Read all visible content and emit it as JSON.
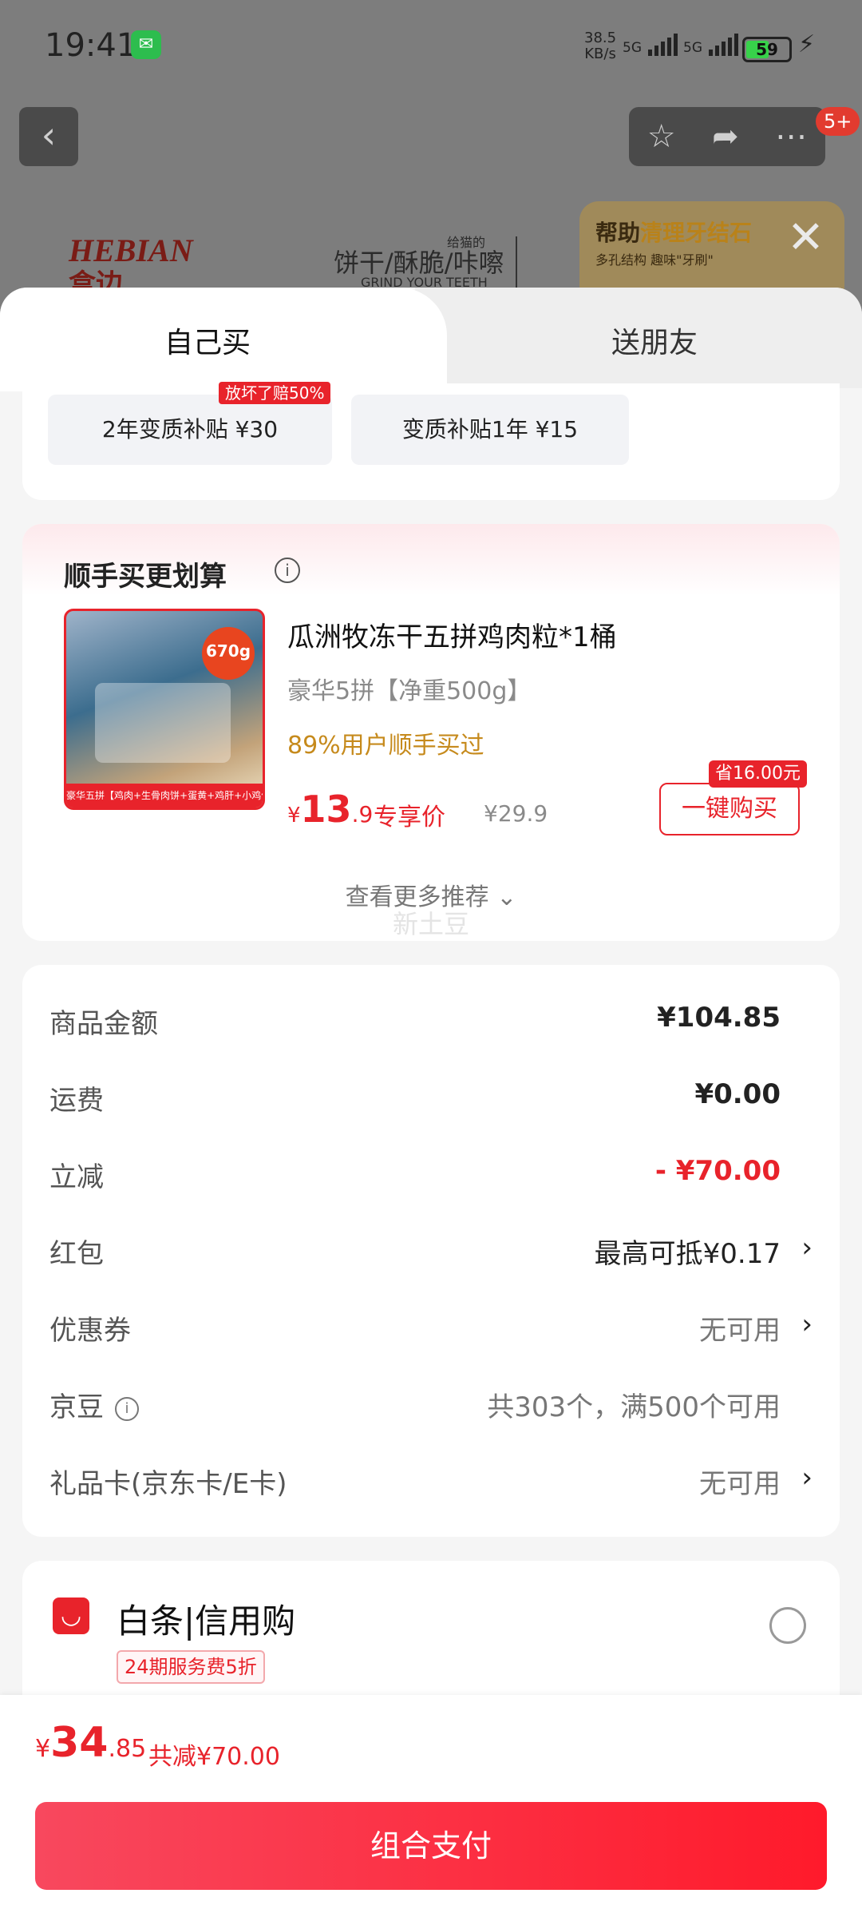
{
  "status_bar": {
    "time": "19:41",
    "net_speed_value": "38.5",
    "net_speed_unit": "KB/s",
    "sim1": "5G",
    "sim2": "5G",
    "battery": "59",
    "battery_level": 0.59
  },
  "top_bar": {
    "badge": "5+"
  },
  "background_banner": {
    "brand_en": "HEBIAN",
    "brand_cn": "盒边",
    "small_text": "给猫的",
    "main_text": "饼干/酥脆/咔嚓",
    "sub_text": "GRIND YOUR TEETH",
    "promo_title_prefix": "帮助",
    "promo_title_highlight": "清理牙结石",
    "promo_sub": "多孔结构 趣味\"牙刷\""
  },
  "tabs": {
    "self": "自己买",
    "friend": "送朋友"
  },
  "subsidy": {
    "tag": "放坏了赔50%",
    "chip1": "2年变质补贴  ¥30",
    "chip2": "变质补贴1年  ¥15"
  },
  "addon": {
    "title": "顺手买更划算",
    "product_name": "瓜洲牧冻干五拼鸡肉粒*1桶",
    "product_spec": "豪华5拼【净重500g】",
    "social_proof": "89%用户顺手买过",
    "price_currency": "¥",
    "price_int": "13",
    "price_dec": ".9",
    "price_tag": "专享价",
    "original_price": "¥29.9",
    "save_tag": "省16.00元",
    "buy_button": "一键购买",
    "image_badge": "670g",
    "image_strip": "豪华五拼【鸡肉+生骨肉饼+蛋黄+鸡肝+小鸡仔】",
    "more": "查看更多推荐 ⌄",
    "watermark": "新土豆"
  },
  "summary": {
    "rows": [
      {
        "label": "商品金额",
        "value": "¥104.85"
      },
      {
        "label": "运费",
        "value": "¥0.00"
      },
      {
        "label": "立减",
        "value": "- ¥70.00"
      },
      {
        "label": "红包",
        "value": "最高可抵¥0.17"
      },
      {
        "label": "优惠券",
        "value": "无可用"
      },
      {
        "label": "京豆",
        "value": "共303个，满500个可用"
      },
      {
        "label": "礼品卡(京东卡/E卡)",
        "value": "无可用"
      }
    ]
  },
  "payment": {
    "method": "白条|信用购",
    "tag": "24期服务费5折"
  },
  "bottom": {
    "currency": "¥",
    "total_int": "34",
    "total_dec": ".85",
    "discount": "共减¥70.00",
    "pay_button": "组合支付"
  },
  "colors": {
    "accent": "#e8232b",
    "orange_text": "#c68a1c"
  }
}
